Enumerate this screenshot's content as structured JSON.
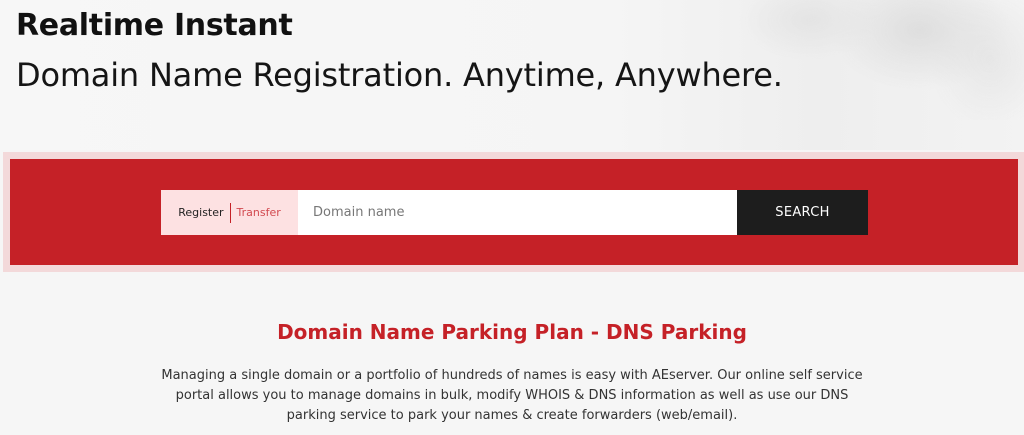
{
  "hero": {
    "title": "Realtime Instant",
    "subtitle": "Domain Name Registration. Anytime, Anywhere."
  },
  "search": {
    "register_label": "Register",
    "transfer_label": "Transfer",
    "placeholder": "Domain name",
    "button_label": "SEARCH"
  },
  "section": {
    "heading": "Domain Name Parking Plan - DNS Parking",
    "body": "Managing a single domain or a portfolio of hundreds of names is easy with AEserver. Our online self service portal allows you to manage domains in bulk, modify WHOIS & DNS information as well as use our DNS parking service to park your names & create forwarders (web/email)."
  },
  "colors": {
    "accent": "#c52127",
    "band_outer": "#f3d9da",
    "toggle_bg": "#fde1e2",
    "button_bg": "#1d1d1d"
  }
}
